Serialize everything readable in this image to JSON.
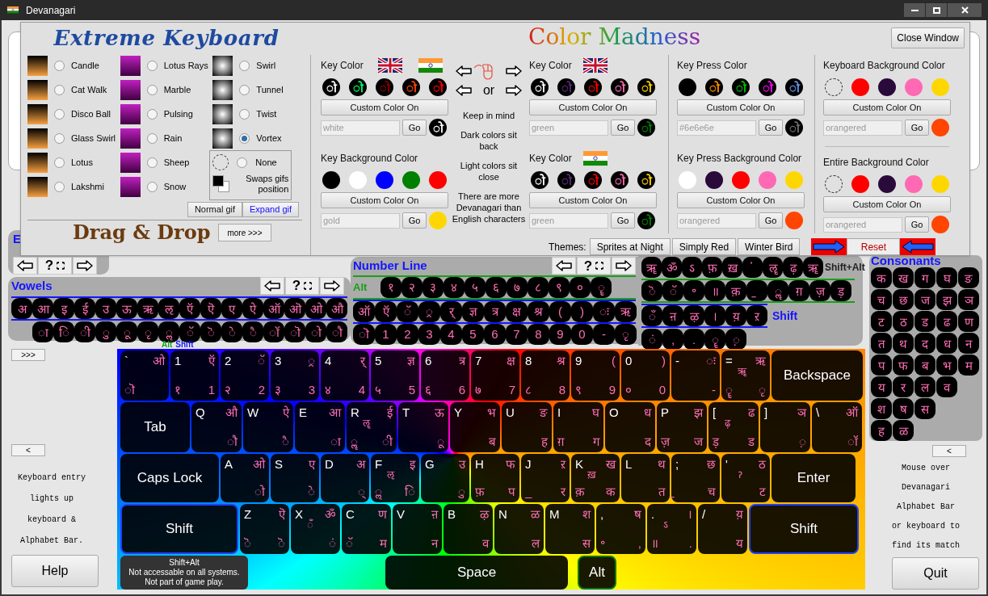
{
  "window": {
    "title": "Devanagari"
  },
  "settings_panel": {
    "logo": "Extreme Keyboard",
    "gif_columns": [
      [
        {
          "label": "Candle",
          "selected": false
        },
        {
          "label": "Cat Walk",
          "selected": false
        },
        {
          "label": "Disco Ball",
          "selected": false
        },
        {
          "label": "Glass Swirl",
          "selected": false
        },
        {
          "label": "Lotus",
          "selected": false
        },
        {
          "label": "Lakshmi",
          "selected": false
        }
      ],
      [
        {
          "label": "Lotus Rays",
          "selected": false
        },
        {
          "label": "Marble",
          "selected": false
        },
        {
          "label": "Pulsing",
          "selected": false
        },
        {
          "label": "Rain",
          "selected": false
        },
        {
          "label": "Sheep",
          "selected": false
        },
        {
          "label": "Snow",
          "selected": false
        }
      ],
      [
        {
          "label": "Swirl",
          "selected": false
        },
        {
          "label": "Tunnel",
          "selected": false
        },
        {
          "label": "Twist",
          "selected": false
        },
        {
          "label": "Vortex",
          "selected": true
        }
      ]
    ],
    "none_option": {
      "label": "None",
      "selected": false
    },
    "swap_label": "Swaps gifs position",
    "gif_buttons": [
      {
        "label": "Normal gif",
        "selected": false
      },
      {
        "label": "Expand gif",
        "selected": true
      }
    ],
    "drag_drop": "Drag & Drop",
    "more_button": "more >>>",
    "color_title": "Color Madness",
    "close_button": "Close Window",
    "columns": [
      [
        {
          "title": "Key Color",
          "kind": "both",
          "swatches": [
            {
              "kind": "glyph",
              "glyph": "ो",
              "color": "#ffffff"
            },
            {
              "kind": "glyph",
              "glyph": "ो",
              "color": "#00ff66"
            },
            {
              "kind": "glyph",
              "glyph": "ो",
              "color": "#8b0000"
            },
            {
              "kind": "glyph",
              "glyph": "ो",
              "color": "#ff4500"
            },
            {
              "kind": "glyph",
              "glyph": "ो",
              "color": "#ff0000"
            }
          ],
          "button": "Custom Color On",
          "placeholder": "white",
          "go": "Go",
          "preview": {
            "kind": "glyph",
            "glyph": "ो",
            "color": "#ffffff"
          }
        },
        {
          "title": "Key Background Color",
          "kind": "plain",
          "swatches": [
            {
              "kind": "solid",
              "color": "#000000"
            },
            {
              "kind": "solid",
              "color": "#ffffff"
            },
            {
              "kind": "solid",
              "color": "#0000ff"
            },
            {
              "kind": "solid",
              "color": "#008000"
            },
            {
              "kind": "solid",
              "color": "#ff0000"
            }
          ],
          "button": "Custom Color On",
          "placeholder": "gold",
          "go": "Go",
          "preview": {
            "kind": "solid",
            "color": "#ffd700"
          }
        }
      ],
      [
        {
          "title": "Key Color",
          "kind": "english",
          "swatches": [
            {
              "kind": "glyph",
              "glyph": "ो",
              "color": "#ffffff"
            },
            {
              "kind": "glyph",
              "glyph": "ो",
              "color": "#5a2a7a"
            },
            {
              "kind": "glyph",
              "glyph": "ो",
              "color": "#ff0000"
            },
            {
              "kind": "glyph",
              "glyph": "ो",
              "color": "#ff69b4"
            },
            {
              "kind": "glyph",
              "glyph": "ो",
              "color": "#ffd700"
            }
          ],
          "button": "Custom Color On",
          "placeholder": "green",
          "go": "Go",
          "preview": {
            "kind": "glyph",
            "glyph": "ो",
            "color": "#008000"
          }
        },
        {
          "title": "Key Color",
          "kind": "devanagari",
          "swatches": [
            {
              "kind": "glyph",
              "glyph": "ो",
              "color": "#ffffff"
            },
            {
              "kind": "glyph",
              "glyph": "ो",
              "color": "#5a2a7a"
            },
            {
              "kind": "glyph",
              "glyph": "ो",
              "color": "#ff0000"
            },
            {
              "kind": "glyph",
              "glyph": "ो",
              "color": "#ff69b4"
            },
            {
              "kind": "glyph",
              "glyph": "ो",
              "color": "#ffd700"
            }
          ],
          "button": "Custom Color On",
          "placeholder": "green",
          "go": "Go",
          "preview": {
            "kind": "glyph",
            "glyph": "ो",
            "color": "#008000"
          }
        }
      ],
      [
        {
          "title": "Key Press Color",
          "kind": "plain",
          "swatches": [
            {
              "kind": "solid",
              "color": "#000000"
            },
            {
              "kind": "glyph",
              "glyph": "ो",
              "color": "#ff8c00"
            },
            {
              "kind": "glyph",
              "glyph": "ो",
              "color": "#00c000"
            },
            {
              "kind": "glyph",
              "glyph": "ो",
              "color": "#ff00ff"
            },
            {
              "kind": "glyph",
              "glyph": "ो",
              "color": "#6495ed"
            }
          ],
          "button": "Custom Color On",
          "placeholder": "#6e6e6e",
          "go": "Go",
          "preview": {
            "kind": "glyph",
            "glyph": "ो",
            "color": "#6e6e6e"
          }
        },
        {
          "title": "Key Press Background Color",
          "kind": "plain",
          "swatches": [
            {
              "kind": "solid",
              "color": "#ffffff"
            },
            {
              "kind": "solid",
              "color": "#2a0a3a"
            },
            {
              "kind": "solid",
              "color": "#ff0000"
            },
            {
              "kind": "solid",
              "color": "#ff69b4"
            },
            {
              "kind": "solid",
              "color": "#ffd700"
            }
          ],
          "button": "Custom Color On",
          "placeholder": "orangered",
          "go": "Go",
          "preview": {
            "kind": "solid",
            "color": "#ff4500"
          }
        }
      ],
      [
        {
          "title": "Keyboard Background Color",
          "kind": "plain",
          "swatches": [
            {
              "kind": "none"
            },
            {
              "kind": "solid",
              "color": "#ff0000"
            },
            {
              "kind": "solid",
              "color": "#2a0a3a"
            },
            {
              "kind": "solid",
              "color": "#ff69b4"
            },
            {
              "kind": "solid",
              "color": "#ffd700"
            }
          ],
          "button": "Custom Color On",
          "placeholder": "orangered",
          "go": "Go",
          "preview": {
            "kind": "solid",
            "color": "#ff4500"
          }
        },
        {
          "title": "Entire Background Color",
          "kind": "plain",
          "swatches": [
            {
              "kind": "none"
            },
            {
              "kind": "solid",
              "color": "#ff0000"
            },
            {
              "kind": "solid",
              "color": "#2a0a3a"
            },
            {
              "kind": "solid",
              "color": "#ff69b4"
            },
            {
              "kind": "solid",
              "color": "#ffd700"
            }
          ],
          "button": "Custom Color On",
          "placeholder": "orangered",
          "go": "Go",
          "preview": {
            "kind": "solid",
            "color": "#ff4500"
          }
        }
      ]
    ],
    "or_label": "or",
    "notes": [
      "Keep in mind",
      "Dark colors sit back",
      "Light colors sit close",
      "There are more Devanagari than English characters"
    ],
    "themes_label": "Themes:",
    "themes": [
      "Sprites at Night",
      "Simply Red",
      "Winter Bird"
    ],
    "reset_button": "Reset"
  },
  "hidden_bar": {
    "title": "E",
    "help": "?"
  },
  "vowels": {
    "title": "Vowels",
    "help": "?",
    "top": [
      "अ",
      "आ",
      "इ",
      "ई",
      "उ",
      "ऊ",
      "ऋ",
      "ऌ",
      "ऍ",
      "ऎ",
      "ए",
      "ऐ",
      "ऑ",
      "ऒ",
      "ओ",
      "औ"
    ],
    "bottom": [
      "ा",
      "ि",
      "ी",
      "ु",
      "ू",
      "ृ",
      "ॢ",
      "ॅ",
      "ॆ",
      "े",
      "ै",
      "ॉ",
      "ॊ",
      "ो",
      "ौ"
    ],
    "alt_label": "Alt",
    "shift_label": "Shift"
  },
  "number_line": {
    "title": "Number Line",
    "help": "?",
    "alt_label": "Alt",
    "alt_row": [
      "१",
      "२",
      "३",
      "४",
      "५",
      "६",
      "७",
      "८",
      "९",
      "०",
      "ॄ"
    ],
    "shift_row": [
      "ऑ",
      "ऍ",
      "ॅ",
      "्र",
      "र्",
      "ज्ञ",
      "त्र",
      "क्ष",
      "श्र",
      "(",
      ")",
      "ः",
      "ऋ"
    ],
    "base_row": [
      "ॊ",
      "1",
      "2",
      "3",
      "4",
      "5",
      "6",
      "7",
      "8",
      "9",
      "0",
      "-",
      "ृ"
    ]
  },
  "symbols": {
    "shift_alt_label": "Shift+Alt",
    "shift_label": "Shift",
    "shift_alt_row": [
      "ॠ",
      "ॐ",
      "ऽ",
      "फ़",
      "ख़",
      "॑",
      "ॡ",
      "ढ़",
      "ॠ"
    ],
    "alt_row": [
      "ॆ",
      "ॅ",
      "॰",
      "॥",
      "क़",
      "॒",
      "ॣ",
      "ग़",
      "ज़",
      "ड़"
    ],
    "shift_row": [
      "ँ",
      "ऩ",
      "ऴ",
      "।",
      "य़",
      "ऱ"
    ],
    "base_row": [
      "ं",
      ",",
      ".",
      "ॄ",
      "़"
    ]
  },
  "consonants": {
    "title": "Consonants",
    "rows": [
      [
        "क",
        "ख",
        "ग",
        "घ",
        "ङ"
      ],
      [
        "च",
        "छ",
        "ज",
        "झ",
        "ञ"
      ],
      [
        "ट",
        "ठ",
        "ड",
        "ढ",
        "ण"
      ],
      [
        "त",
        "थ",
        "द",
        "ध",
        "न"
      ],
      [
        "प",
        "फ",
        "ब",
        "भ",
        "म"
      ],
      [
        "य",
        "र",
        "ल",
        "व"
      ],
      [
        "श",
        "ष",
        "स"
      ],
      [
        "ह",
        "ळ"
      ]
    ]
  },
  "left_sidebar": {
    "expand_button": ">>>",
    "collapse_button": "<",
    "note": "Keyboard entry lights up keyboard & Alphabet Bar.",
    "help_button": "Help"
  },
  "right_sidebar": {
    "collapse_button": "<",
    "note": "Mouse over Devanagari Alphabet Bar or keyboard to find its match",
    "quit_button": "Quit"
  },
  "keyboard": {
    "rows": [
      {
        "keys": [
          {
            "kind": "char",
            "en": "`",
            "shift": "ओ",
            "alt": "ॊ"
          },
          {
            "kind": "char",
            "en": "1",
            "shift": "ऍ",
            "alt": "१",
            "main": "1"
          },
          {
            "kind": "char",
            "en": "2",
            "shift": "ॅ",
            "alt": "२",
            "main": "2"
          },
          {
            "kind": "char",
            "en": "3",
            "shift": "्र",
            "alt": "३",
            "main": "3"
          },
          {
            "kind": "char",
            "en": "4",
            "shift": "र्",
            "alt": "४",
            "main": "4"
          },
          {
            "kind": "char",
            "en": "5",
            "shift": "ज्ञ",
            "alt": "५",
            "main": "5"
          },
          {
            "kind": "char",
            "en": "6",
            "shift": "त्र",
            "alt": "६",
            "main": "6"
          },
          {
            "kind": "char",
            "en": "7",
            "shift": "क्ष",
            "alt": "७",
            "main": "7"
          },
          {
            "kind": "char",
            "en": "8",
            "shift": "श्र",
            "alt": "८",
            "main": "8"
          },
          {
            "kind": "char",
            "en": "9",
            "shift": "(",
            "alt": "९",
            "main": "9"
          },
          {
            "kind": "char",
            "en": "0",
            "shift": ")",
            "alt": "०",
            "main": "0"
          },
          {
            "kind": "char",
            "en": "-",
            "shift": "ः",
            "main": "-"
          },
          {
            "kind": "char",
            "en": "=",
            "shift": "ऋ",
            "extra": "ॠ",
            "alt": "ॄ",
            "main": "ृ"
          }
        ],
        "right_key": {
          "kind": "wide",
          "label": "Backspace"
        }
      },
      {
        "left_key": {
          "kind": "wide",
          "label": "Tab"
        },
        "keys": [
          {
            "kind": "char",
            "en": "Q",
            "shift": "औ",
            "main": "ौ"
          },
          {
            "kind": "char",
            "en": "W",
            "shift": "ऐ",
            "main": "ै"
          },
          {
            "kind": "char",
            "en": "E",
            "shift": "आ",
            "main": "ा"
          },
          {
            "kind": "char",
            "en": "R",
            "shift": "ई",
            "extra": "ॡ",
            "alt": "ॣ",
            "main": "ी"
          },
          {
            "kind": "char",
            "en": "T",
            "shift": "ऊ",
            "main": "ू"
          },
          {
            "kind": "char",
            "en": "Y",
            "shift": "भ",
            "main": "ब"
          },
          {
            "kind": "char",
            "en": "U",
            "shift": "ङ",
            "main": "ह"
          },
          {
            "kind": "char",
            "en": "I",
            "shift": "घ",
            "alt": "ग़",
            "main": "ग"
          },
          {
            "kind": "char",
            "en": "O",
            "shift": "ध",
            "main": "द"
          },
          {
            "kind": "char",
            "en": "P",
            "shift": "झ",
            "alt": "ज़",
            "main": "ज"
          },
          {
            "kind": "char",
            "en": "[",
            "shift": "ढ",
            "extra": "ढ़",
            "alt": "ड़",
            "main": "ड"
          },
          {
            "kind": "char",
            "en": "]",
            "shift": "ञ",
            "main": "़"
          },
          {
            "kind": "char",
            "en": "\\",
            "shift": "ऑ",
            "main": "ॉ"
          }
        ]
      },
      {
        "left_key": {
          "kind": "wide",
          "label": "Caps Lock"
        },
        "keys": [
          {
            "kind": "char",
            "en": "A",
            "shift": "ओ",
            "main": "ो"
          },
          {
            "kind": "char",
            "en": "S",
            "shift": "ए",
            "main": "े"
          },
          {
            "kind": "char",
            "en": "D",
            "shift": "अ",
            "main": "्"
          },
          {
            "kind": "char",
            "en": "F",
            "shift": "इ",
            "extra": "ऌ",
            "alt": "ॢ",
            "main": "ि"
          },
          {
            "kind": "char",
            "en": "G",
            "shift": "उ",
            "main": "ु"
          },
          {
            "kind": "char",
            "en": "H",
            "shift": "फ",
            "alt": "फ़",
            "main": "प"
          },
          {
            "kind": "char",
            "en": "J",
            "shift": "ऱ",
            "alt": "_",
            "main": "र"
          },
          {
            "kind": "char",
            "en": "K",
            "shift": "ख",
            "extra": "ख़",
            "alt": "क़",
            "main": "क"
          },
          {
            "kind": "char",
            "en": "L",
            "shift": "थ",
            "main": "त"
          },
          {
            "kind": "char",
            "en": ";",
            "shift": "छ",
            "alt": "॒",
            "main": "च"
          },
          {
            "kind": "char",
            "en": "'",
            "shift": "ठ",
            "extra": "ॽ",
            "main": "ट"
          }
        ],
        "right_key": {
          "kind": "wide",
          "label": "Enter"
        }
      },
      {
        "left_key": {
          "kind": "wide",
          "label": "Shift",
          "color": "#1f3fff"
        },
        "keys": [
          {
            "kind": "char",
            "en": "Z",
            "shift": "ऎ",
            "alt": "ॆ",
            "main": "ॆ"
          },
          {
            "kind": "char",
            "en": "X",
            "shift": "ॐ",
            "extra": "ँ",
            "main": "ं"
          },
          {
            "kind": "char",
            "en": "C",
            "shift": "ण",
            "alt": "ॅ",
            "main": "म"
          },
          {
            "kind": "char",
            "en": "V",
            "shift": "ऩ",
            "main": "न"
          },
          {
            "kind": "char",
            "en": "B",
            "shift": "ऴ",
            "main": "व"
          },
          {
            "kind": "char",
            "en": "N",
            "shift": "ळ",
            "main": "ल"
          },
          {
            "kind": "char",
            "en": "M",
            "shift": "श",
            "main": "स"
          },
          {
            "kind": "char",
            "en": ",",
            "shift": "ष",
            "alt": "॰",
            "main": ","
          },
          {
            "kind": "char",
            "en": ".",
            "shift": "।",
            "extra": "ऽ",
            "alt": "॥",
            "main": "."
          },
          {
            "kind": "char",
            "en": "/",
            "shift": "य़",
            "main": "य"
          }
        ],
        "right_key": {
          "kind": "wide",
          "label": "Shift",
          "color": "#1f3fff"
        }
      }
    ],
    "tooltip": [
      "Shift+Alt",
      "Not accessable on all systems.",
      "Not part of game play."
    ],
    "space_key": "Space",
    "alt_key": {
      "label": "Alt",
      "color": "#0a7a0a"
    }
  }
}
